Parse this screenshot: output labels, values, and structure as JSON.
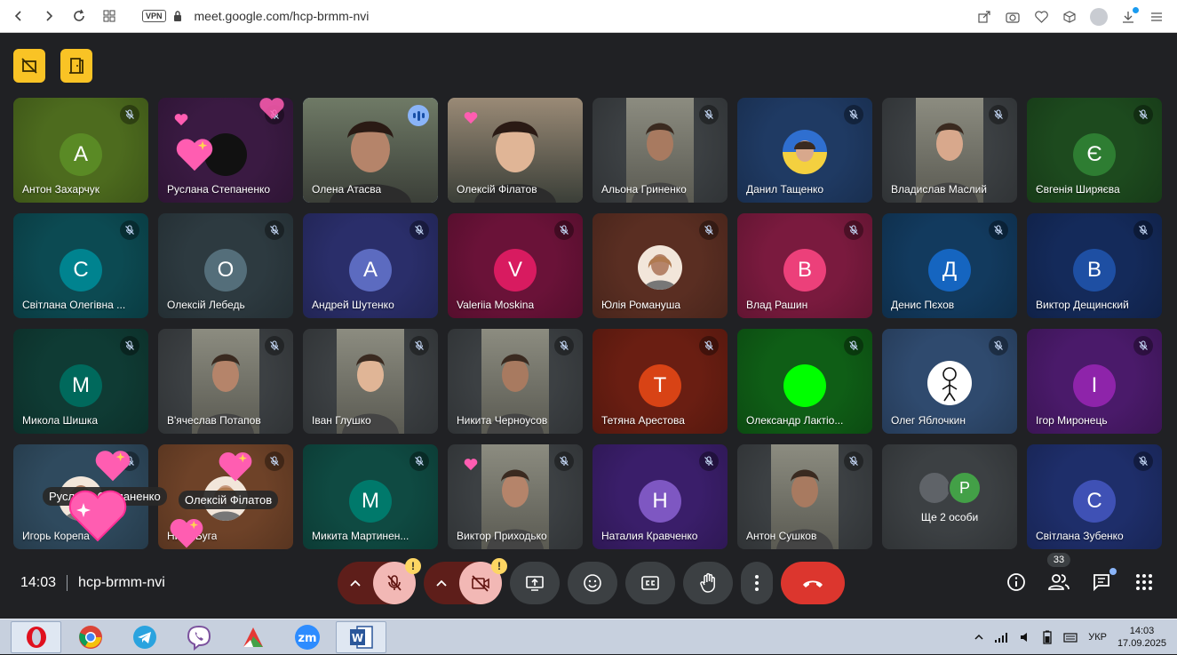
{
  "browser": {
    "vpn": "VPN",
    "url": "meet.google.com/hcp-brmm-nvi"
  },
  "participants": [
    {
      "name": "Антон Захарчук",
      "letter": "А",
      "bg": "#4d6b1e",
      "avatar": "#5a8a25"
    },
    {
      "name": "Руслана Степаненко",
      "letter": "",
      "bg": "#3a1a42",
      "avatar": "#111111"
    },
    {
      "name": "Олена Атасва",
      "letter": "",
      "bg": "#6f7a66",
      "avatar": ""
    },
    {
      "name": "Олексій Філатов",
      "letter": "",
      "bg": "#9a8a76",
      "avatar": ""
    },
    {
      "name": "Альона Гриненко",
      "letter": "",
      "bg": "#3c4043",
      "avatar": ""
    },
    {
      "name": "Данил Тащенко",
      "letter": "",
      "bg": "#1f3a63",
      "avatar": ""
    },
    {
      "name": "Владислав Маслий",
      "letter": "",
      "bg": "#3c4043",
      "avatar": ""
    },
    {
      "name": "Євгенія Ширяєва",
      "letter": "Є",
      "bg": "#1d4a1e",
      "avatar": "#2e7d32"
    },
    {
      "name": "Світлана Олегівна ...",
      "letter": "С",
      "bg": "#0c4a52",
      "avatar": "#00838f"
    },
    {
      "name": "Олексій Лебедь",
      "letter": "О",
      "bg": "#2d3a40",
      "avatar": "#546e7a"
    },
    {
      "name": "Андрей Шутенко",
      "letter": "А",
      "bg": "#2a2e6a",
      "avatar": "#5c6bc0"
    },
    {
      "name": "Valeriia Moskina",
      "letter": "V",
      "bg": "#6a1238",
      "avatar": "#d81b60"
    },
    {
      "name": "Юлія Романуша",
      "letter": "",
      "bg": "#5a2e22",
      "avatar": ""
    },
    {
      "name": "Влад Рашин",
      "letter": "В",
      "bg": "#7a1a3e",
      "avatar": "#ec407a"
    },
    {
      "name": "Денис Пєхов",
      "letter": "Д",
      "bg": "#123a5e",
      "avatar": "#1565c0"
    },
    {
      "name": "Виктор Дещинский",
      "letter": "В",
      "bg": "#142a5a",
      "avatar": "#1e4fa3"
    },
    {
      "name": "Микола Шишка",
      "letter": "М",
      "bg": "#0f3b34",
      "avatar": "#00695c"
    },
    {
      "name": "В'ячеслав Потапов",
      "letter": "",
      "bg": "#3c4043",
      "avatar": ""
    },
    {
      "name": "Іван Глушко",
      "letter": "",
      "bg": "#3c4043",
      "avatar": ""
    },
    {
      "name": "Никита Черноусов",
      "letter": "",
      "bg": "#3c4043",
      "avatar": ""
    },
    {
      "name": "Тетяна Арестова",
      "letter": "Т",
      "bg": "#6a1e12",
      "avatar": "#d84315"
    },
    {
      "name": "Олександр Лактіо...",
      "letter": "",
      "bg": "#0f5e16",
      "avatar": "#00ff00"
    },
    {
      "name": "Олег Яблочкин",
      "letter": "",
      "bg": "#2f4a6e",
      "avatar": "#ffffff"
    },
    {
      "name": "Ігор Миронець",
      "letter": "І",
      "bg": "#4a1a6a",
      "avatar": "#8e24aa"
    },
    {
      "name": "Игорь Корепа",
      "letter": "",
      "bg": "#2f4a5e",
      "avatar": ""
    },
    {
      "name": "Нина Буга",
      "letter": "",
      "bg": "#6e4228",
      "avatar": ""
    },
    {
      "name": "Микита Мартинен...",
      "letter": "М",
      "bg": "#0f4a42",
      "avatar": "#00796b"
    },
    {
      "name": "Виктор Приходько",
      "letter": "",
      "bg": "#3c4043",
      "avatar": ""
    },
    {
      "name": "Наталия Кравченко",
      "letter": "Н",
      "bg": "#3a1e6a",
      "avatar": "#7e57c2"
    },
    {
      "name": "Антон Сушков",
      "letter": "",
      "bg": "#3c4043",
      "avatar": ""
    },
    {
      "name": "Ще 2 особи",
      "letter": "Р",
      "bg": "#3c4043",
      "avatar": "#43a047"
    },
    {
      "name": "Світлана Зубенко",
      "letter": "С",
      "bg": "#1e2e6a",
      "avatar": "#3f51b5"
    }
  ],
  "floating_labels": {
    "left": "Руслана Степаненко",
    "right": "Олексій Філатов"
  },
  "meeting": {
    "time": "14:03",
    "code": "hcp-brmm-nvi",
    "people_count": "33",
    "warn_mark": "!"
  },
  "taskbar": {
    "lang": "УКР",
    "time": "14:03",
    "date": "17.09.2025"
  },
  "colors": {
    "accent_yellow": "#f9c325",
    "hangup": "#dc362e",
    "muted_control": "#f2b8b5",
    "active_outline": "#a8c7fa"
  }
}
